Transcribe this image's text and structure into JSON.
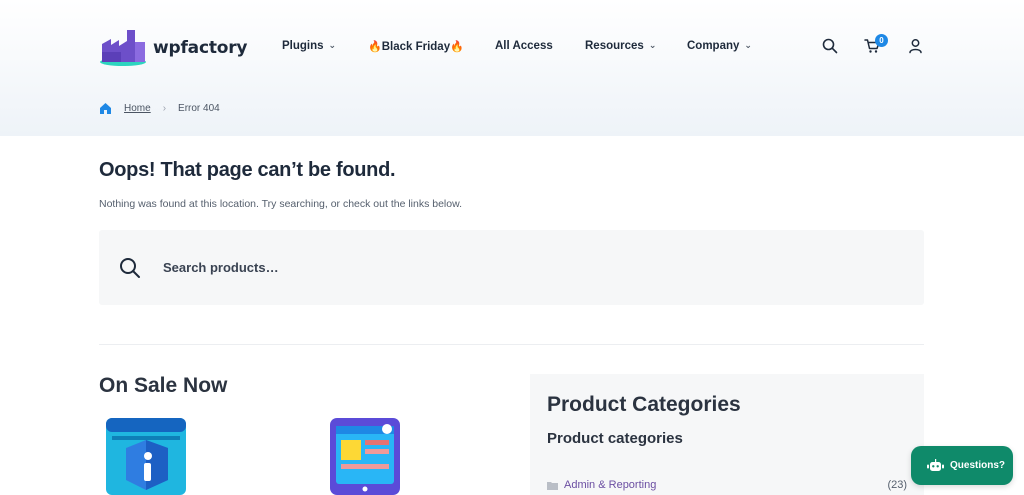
{
  "brand": {
    "name": "wpfactory",
    "accent": "#1e88e5",
    "green": "#0f8a6a"
  },
  "nav": {
    "items": [
      {
        "label": "Plugins",
        "has_dropdown": true
      },
      {
        "label": "Black Friday",
        "icon": "flame-icon"
      },
      {
        "label": "All Access",
        "has_dropdown": false
      },
      {
        "label": "Resources",
        "has_dropdown": true
      },
      {
        "label": "Company",
        "has_dropdown": true
      }
    ],
    "chevron": "⌄",
    "flame": "🔥"
  },
  "header": {
    "cart_count": "0"
  },
  "breadcrumb": {
    "home": "Home",
    "separator": "›",
    "current": "Error 404"
  },
  "main": {
    "title": "Oops! That page can’t be found.",
    "description": "Nothing was found at this location. Try searching, or check out the links below.",
    "search_placeholder": "Search products…",
    "on_sale_title": "On Sale Now"
  },
  "categories": {
    "title": "Product Categories",
    "subtitle": "Product categories",
    "items": [
      {
        "label": "Admin & Reporting",
        "count": "(23)"
      }
    ]
  },
  "chat": {
    "label": "Questions?"
  }
}
